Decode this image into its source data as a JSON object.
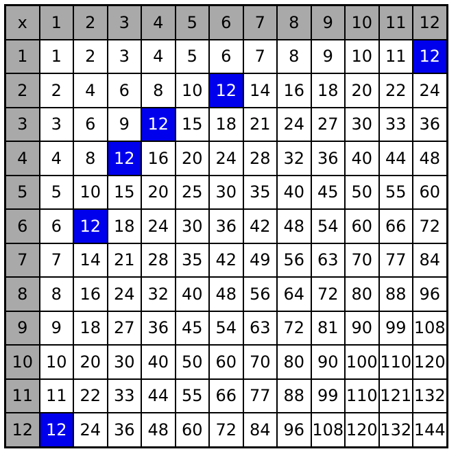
{
  "chart_data": {
    "type": "table",
    "title": "",
    "size": 12,
    "headers_row": [
      "x",
      "1",
      "2",
      "3",
      "4",
      "5",
      "6",
      "7",
      "8",
      "9",
      "10",
      "11",
      "12"
    ],
    "headers_col": [
      "1",
      "2",
      "3",
      "4",
      "5",
      "6",
      "7",
      "8",
      "9",
      "10",
      "11",
      "12"
    ],
    "values": [
      [
        1,
        2,
        3,
        4,
        5,
        6,
        7,
        8,
        9,
        10,
        11,
        12
      ],
      [
        2,
        4,
        6,
        8,
        10,
        12,
        14,
        16,
        18,
        20,
        22,
        24
      ],
      [
        3,
        6,
        9,
        12,
        15,
        18,
        21,
        24,
        27,
        30,
        33,
        36
      ],
      [
        4,
        8,
        12,
        16,
        20,
        24,
        28,
        32,
        36,
        40,
        44,
        48
      ],
      [
        5,
        10,
        15,
        20,
        25,
        30,
        35,
        40,
        45,
        50,
        55,
        60
      ],
      [
        6,
        12,
        18,
        24,
        30,
        36,
        42,
        48,
        54,
        60,
        66,
        72
      ],
      [
        7,
        14,
        21,
        28,
        35,
        42,
        49,
        56,
        63,
        70,
        77,
        84
      ],
      [
        8,
        16,
        24,
        32,
        40,
        48,
        56,
        64,
        72,
        80,
        88,
        96
      ],
      [
        9,
        18,
        27,
        36,
        45,
        54,
        63,
        72,
        81,
        90,
        99,
        108
      ],
      [
        10,
        20,
        30,
        40,
        50,
        60,
        70,
        80,
        90,
        100,
        110,
        120
      ],
      [
        11,
        22,
        33,
        44,
        55,
        66,
        77,
        88,
        99,
        110,
        121,
        132
      ],
      [
        12,
        24,
        36,
        48,
        60,
        72,
        84,
        96,
        108,
        120,
        132,
        144
      ]
    ],
    "highlight_value": 12,
    "highlight_cells": [
      {
        "row": 1,
        "col": 12
      },
      {
        "row": 2,
        "col": 6
      },
      {
        "row": 3,
        "col": 4
      },
      {
        "row": 4,
        "col": 3
      },
      {
        "row": 6,
        "col": 2
      },
      {
        "row": 12,
        "col": 1
      }
    ]
  }
}
